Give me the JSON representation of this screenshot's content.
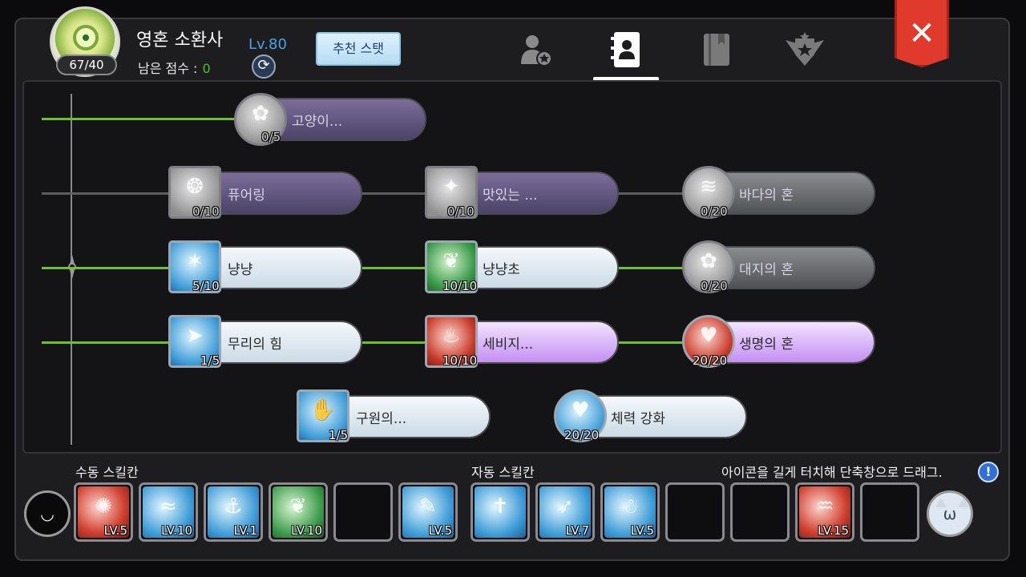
{
  "header": {
    "points": "67/40",
    "class_name": "영혼 소환사",
    "level": "Lv.80",
    "remaining_label": "남은 점수 :",
    "remaining_value": "0",
    "recommend_button": "추천 스탯",
    "close_label": "✕",
    "tabs": [
      {
        "icon": "character-star-icon",
        "active": false
      },
      {
        "icon": "contact-book-icon",
        "active": true
      },
      {
        "icon": "book-icon",
        "active": false
      },
      {
        "icon": "emblem-star-icon",
        "active": false
      }
    ]
  },
  "tree": {
    "rows": [
      [
        {
          "name": "고양이...",
          "count": "0/5",
          "state": "locked",
          "shape": "round"
        }
      ],
      [
        {
          "name": "퓨어링",
          "count": "0/10",
          "state": "locked",
          "shape": "square"
        },
        {
          "name": "맛있는 ...",
          "count": "0/10",
          "state": "locked",
          "shape": "square"
        },
        {
          "name": "바다의 혼",
          "count": "0/20",
          "state": "locked",
          "shape": "round"
        }
      ],
      [
        {
          "name": "냥냥",
          "count": "5/10",
          "state": "active",
          "shape": "square"
        },
        {
          "name": "냥냥초",
          "count": "10/10",
          "state": "active",
          "shape": "square"
        },
        {
          "name": "대지의 혼",
          "count": "0/20",
          "state": "locked",
          "shape": "round"
        }
      ],
      [
        {
          "name": "무리의 힘",
          "count": "1/5",
          "state": "active",
          "shape": "square"
        },
        {
          "name": "세비지...",
          "count": "10/10",
          "state": "active",
          "shape": "square"
        },
        {
          "name": "생명의 혼",
          "count": "20/20",
          "state": "active",
          "shape": "round"
        }
      ],
      [
        {
          "name": "구원의...",
          "count": "1/5",
          "state": "active",
          "shape": "square"
        },
        {
          "name": "체력 강화",
          "count": "20/20",
          "state": "active",
          "shape": "round"
        }
      ]
    ]
  },
  "bottom": {
    "manual_label": "수동 스킬칸",
    "auto_label": "자동 스킬칸",
    "hint_text": "아이콘을 길게 터치해 단축창으로 드래그.",
    "hint_icon": "!",
    "manual_slots": [
      {
        "lv": "LV.5",
        "color": "red"
      },
      {
        "lv": "LV.10",
        "color": "blue"
      },
      {
        "lv": "LV.1",
        "color": "blue"
      },
      {
        "lv": "LV.10",
        "color": "green"
      },
      {
        "lv": "",
        "color": "empty"
      },
      {
        "lv": "LV.5",
        "color": "blue"
      }
    ],
    "auto_slots": [
      {
        "lv": "",
        "color": "blue"
      },
      {
        "lv": "LV.7",
        "color": "blue"
      },
      {
        "lv": "LV.5",
        "color": "blue"
      },
      {
        "lv": "",
        "color": "empty"
      },
      {
        "lv": "",
        "color": "empty"
      },
      {
        "lv": "LV.15",
        "color": "red"
      },
      {
        "lv": "",
        "color": "empty"
      }
    ]
  }
}
